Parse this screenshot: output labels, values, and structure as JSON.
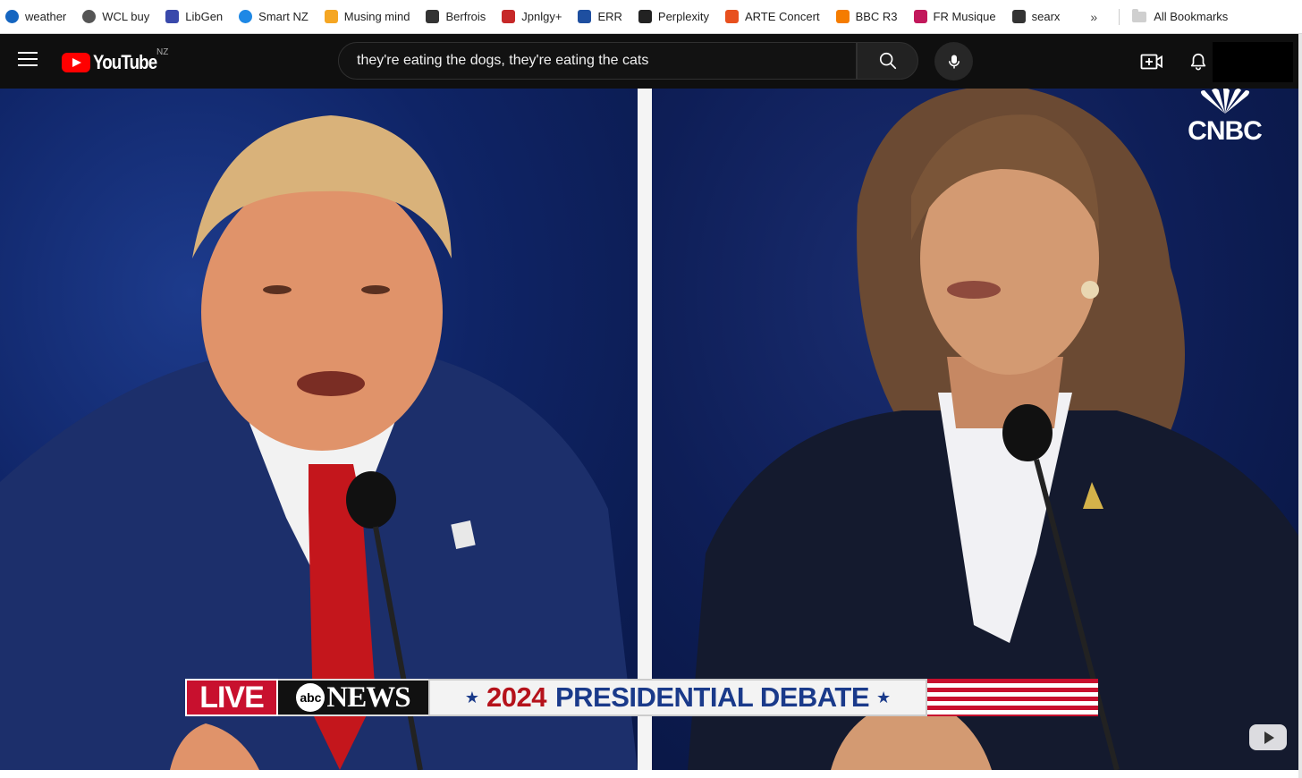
{
  "bookmarks": {
    "items": [
      {
        "label": "weather",
        "icon": "weather-favicon",
        "color": "#1565c0"
      },
      {
        "label": "WCL buy",
        "icon": "globe-icon",
        "color": "#555555"
      },
      {
        "label": "LibGen",
        "icon": "libgen-favicon",
        "color": "#3949ab"
      },
      {
        "label": "Smart NZ",
        "icon": "smartnz-favicon",
        "color": "#1e88e5"
      },
      {
        "label": "Musing mind",
        "icon": "musing-favicon",
        "color": "#f5a623"
      },
      {
        "label": "Berfrois",
        "icon": "berfrois-favicon",
        "color": "#333333"
      },
      {
        "label": "Jpnlgy+",
        "icon": "nhk-favicon",
        "color": "#c62828"
      },
      {
        "label": "ERR",
        "icon": "err-favicon",
        "color": "#1e4fa0"
      },
      {
        "label": "Perplexity",
        "icon": "perplexity-favicon",
        "color": "#222222"
      },
      {
        "label": "ARTE Concert",
        "icon": "arte-favicon",
        "color": "#e8501e"
      },
      {
        "label": "BBC R3",
        "icon": "bbc-favicon",
        "color": "#f57c00"
      },
      {
        "label": "FR Musique",
        "icon": "frmusique-favicon",
        "color": "#c2185b"
      },
      {
        "label": "searx",
        "icon": "searx-favicon",
        "color": "#333333"
      }
    ],
    "more": "»",
    "all_bookmarks": "All Bookmarks"
  },
  "header": {
    "logo_text": "YouTube",
    "country_code": "NZ",
    "search_value": "they're eating the dogs, they're eating the cats",
    "search_placeholder": "Search"
  },
  "video": {
    "watermark": "CNBC",
    "chyron": {
      "live": "LIVE",
      "abc": "abc",
      "news": "NEWS",
      "year": "2024",
      "title": "PRESIDENTIAL DEBATE"
    }
  },
  "colors": {
    "accent": "#ff0000",
    "header_bg": "#0f0f0f",
    "chyron_red": "#c8102e",
    "chyron_blue": "#1a3a8a"
  }
}
